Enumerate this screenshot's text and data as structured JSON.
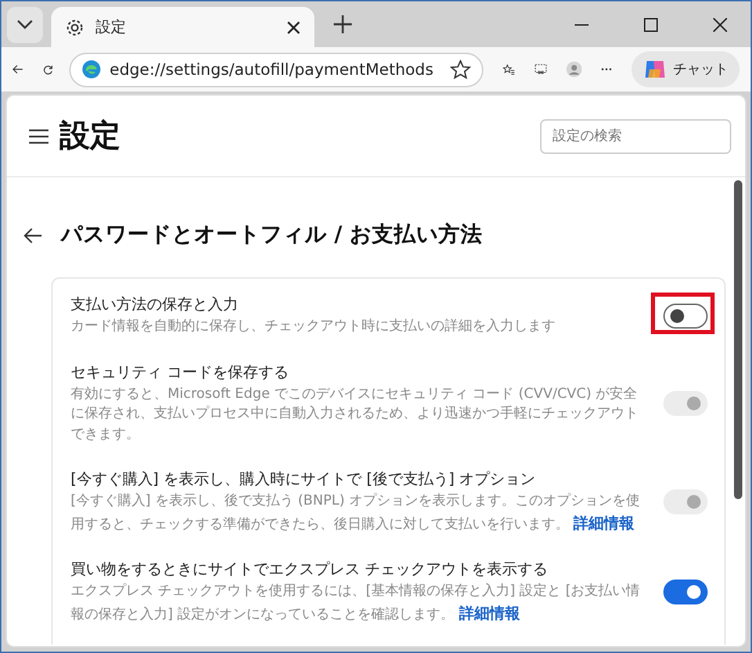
{
  "tabs": [
    {
      "title": "設定",
      "selected": true
    }
  ],
  "address_bar": {
    "url": "edge://settings/autofill/paymentMethods"
  },
  "chat_button": {
    "label": "チャット"
  },
  "settings_header": {
    "title": "設定",
    "search": {
      "placeholder": "設定の検索"
    }
  },
  "page_title": "パスワードとオートフィル / お支払い方法",
  "settings": [
    {
      "title": "支払い方法の保存と入力",
      "description": "カード情報を自動的に保存し、チェックアウト時に支払いの詳細を入力します",
      "on": false,
      "disabled": false,
      "highlighted": true
    },
    {
      "title": "セキュリティ コードを保存する",
      "description": "有効にすると、Microsoft Edge でこのデバイスにセキュリティ コード (CVV/CVC) が安全に保存され、支払いプロセス中に自動入力されるため、より迅速かつ手軽にチェックアウトできます。",
      "on": true,
      "disabled": true
    },
    {
      "title": "[今すぐ購入] を表示し、購入時にサイトで [後で支払う] オプション",
      "description": "[今すぐ購入] を表示し、後で支払う (BNPL) オプションを表示します。このオプションを使用すると、チェックする準備ができたら、後日購入に対して支払いを行います。",
      "link": "詳細情報",
      "on": true,
      "disabled": true
    },
    {
      "title": "買い物をするときにサイトでエクスプレス チェックアウトを表示する",
      "description": "エクスプレス チェックアウトを使用するには、[基本情報の保存と入力] 設定と [お支払い情報の保存と入力] 設定がオンになっていることを確認します。",
      "link": "詳細情報",
      "on": true,
      "disabled": false
    }
  ]
}
